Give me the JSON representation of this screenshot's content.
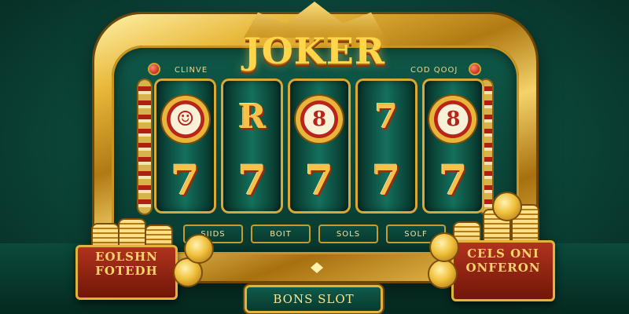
{
  "machine": {
    "title": "JOKER",
    "sub_left": "CLINVE",
    "sub_right": "COD QOOJ"
  },
  "reels": [
    {
      "top": "joker-face",
      "bottom": "7"
    },
    {
      "top": "R",
      "bottom": "7"
    },
    {
      "top": "8",
      "bottom": "7"
    },
    {
      "top": "7",
      "bottom": "7"
    },
    {
      "top": "8",
      "bottom": "7"
    }
  ],
  "buttons": [
    "SIIDS",
    "BOIT",
    "SOLS",
    "SOLF"
  ],
  "bonus_button": "BONS SLOT",
  "chest_left": {
    "line1": "EOLSHN",
    "line2": "FOTEDH"
  },
  "chest_right": {
    "line1": "CELS ONI",
    "line2": "ONFERON"
  },
  "colors": {
    "gold": "#e2b33b",
    "felt": "#0d4a3d",
    "red": "#b01f12"
  }
}
